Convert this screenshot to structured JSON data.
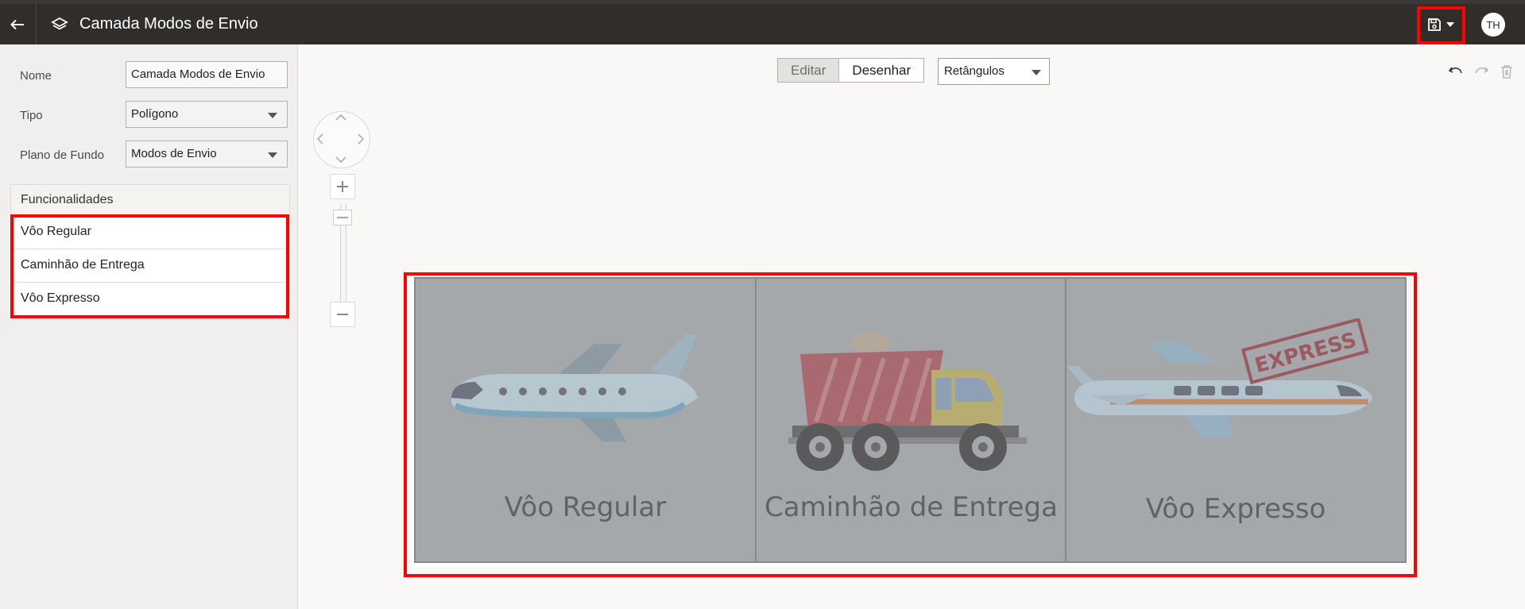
{
  "header": {
    "title": "Camada Modos de Envio",
    "avatar_initials": "TH"
  },
  "properties": {
    "name_label": "Nome",
    "name_value": "Camada Modos de Envio",
    "type_label": "Tipo",
    "type_value": "Polígono",
    "background_label": "Plano de Fundo",
    "background_value": "Modos de Envio"
  },
  "features": {
    "heading": "Funcionalidades",
    "items": [
      {
        "label": "Vôo Regular"
      },
      {
        "label": "Caminhão de Entrega"
      },
      {
        "label": "Vôo Expresso"
      }
    ]
  },
  "toolbar": {
    "edit_label": "Editar",
    "draw_label": "Desenhar",
    "shape_value": "Retângulos"
  },
  "canvas": {
    "panels": [
      {
        "label": "Vôo Regular",
        "icon": "airplane-icon"
      },
      {
        "label": "Caminhão de Entrega",
        "icon": "dump-truck-icon"
      },
      {
        "label": "Vôo Expresso",
        "icon": "express-airplane-icon",
        "stamp": "EXPRESS"
      }
    ]
  },
  "colors": {
    "header_bg": "#312d2a",
    "highlight": "#ff0000",
    "panel_overlay": "#a5a8ab"
  }
}
